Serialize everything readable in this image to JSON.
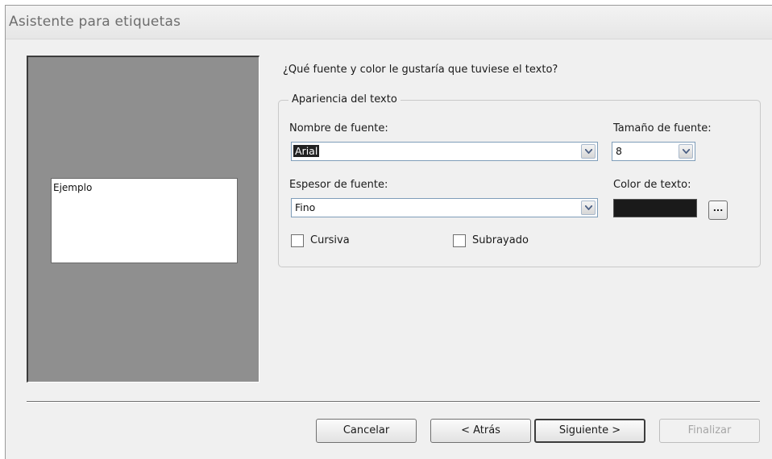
{
  "window": {
    "title": "Asistente para etiquetas"
  },
  "preview": {
    "sample_text": "Ejemplo"
  },
  "question": "¿Qué fuente y color le gustaría que tuviese el texto?",
  "appearance": {
    "legend": "Apariencia del texto",
    "font_name": {
      "label": "Nombre de fuente:",
      "value": "Arial"
    },
    "font_size": {
      "label": "Tamaño de fuente:",
      "value": "8"
    },
    "font_weight": {
      "label": "Espesor de fuente:",
      "value": "Fino"
    },
    "text_color": {
      "label": "Color de texto:",
      "swatch": "#1a1a1a",
      "button_label": "..."
    },
    "italic": {
      "label": "Cursiva",
      "checked": false
    },
    "underline": {
      "label": "Subrayado",
      "checked": false
    }
  },
  "buttons": {
    "cancel": "Cancelar",
    "back": "< Atrás",
    "next": "Siguiente >",
    "finish": "Finalizar"
  }
}
